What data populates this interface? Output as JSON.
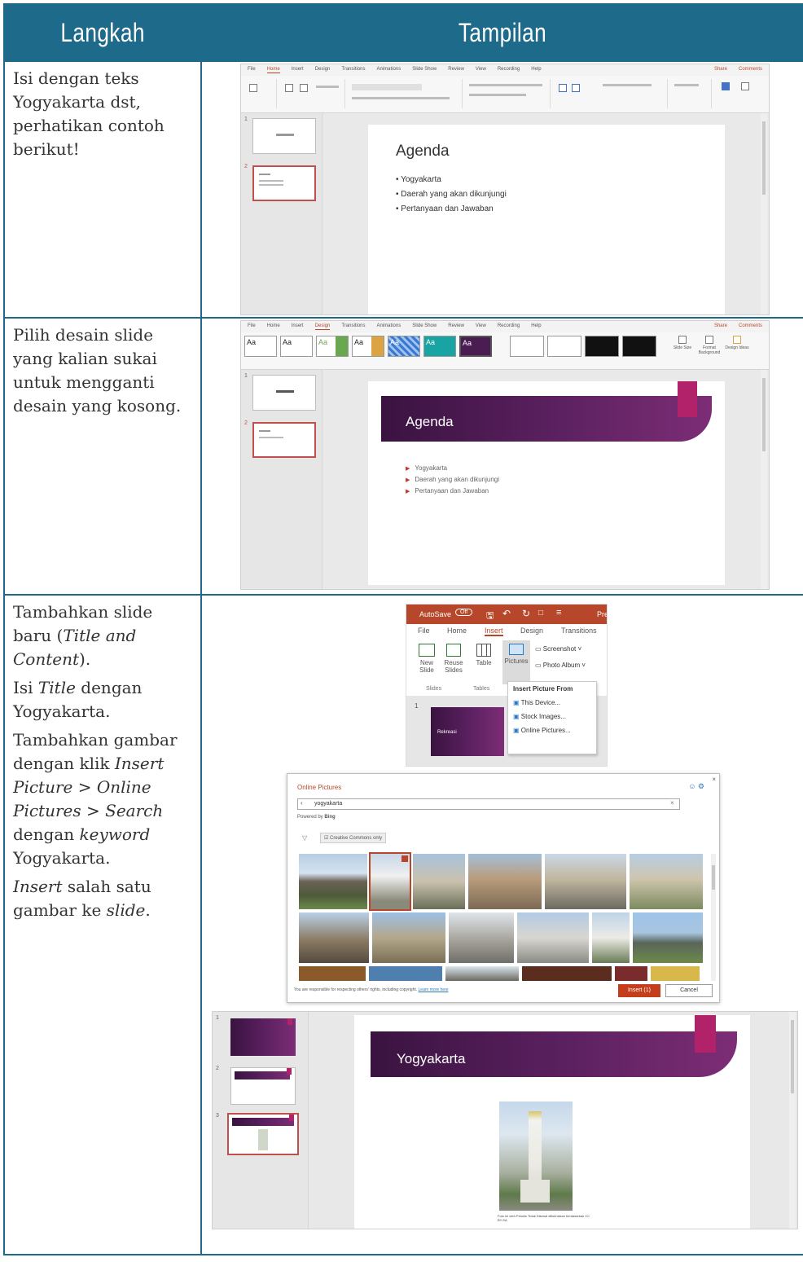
{
  "header": {
    "col_step": "Langkah",
    "col_view": "Tampilan"
  },
  "rows": [
    {
      "step_text": "Isi dengan teks Yogyakarta dst, perhatikan contoh berikut!"
    },
    {
      "step_text": "Pilih desain slide yang kalian sukai untuk mengganti desain yang kosong."
    },
    {
      "step_html_parts": {
        "p1a": "Tambahkan slide baru (",
        "p1b": "Title and Content",
        "p1c": ").",
        "p2a": "Isi ",
        "p2b": "Title",
        "p2c": " dengan Yogyakarta.",
        "p3a": "Tambahkan gambar dengan klik ",
        "p3b": "Insert Picture",
        "p3c": " > ",
        "p3d": "Online Pictures",
        "p3e": " > ",
        "p3f": "Search",
        "p3g": " dengan ",
        "p3h": "keyword",
        "p3i": " Yogyakarta.",
        "p4a": "Insert",
        "p4b": " salah satu gambar ke ",
        "p4c": "slide",
        "p4d": "."
      }
    }
  ],
  "screen1": {
    "tabs": [
      "File",
      "Home",
      "Insert",
      "Design",
      "Transitions",
      "Animations",
      "Slide Show",
      "Review",
      "View",
      "Recording",
      "Help"
    ],
    "share": "Share",
    "comments": "Comments",
    "slide_title": "Agenda",
    "bullets": [
      "Yogyakarta",
      "Daerah yang akan dikunjungi",
      "Pertanyaan dan Jawaban"
    ],
    "thumb_numbers": [
      "1",
      "2"
    ]
  },
  "screen2": {
    "slide_title": "Agenda",
    "bullets": [
      "Yogyakarta",
      "Daerah yang akan dikunjungi",
      "Pertanyaan dan Jawaban"
    ],
    "thumb_numbers": [
      "1",
      "2"
    ],
    "theme_label": "Aa",
    "customize": [
      "Slide Size",
      "Format Background",
      "Design Ideas"
    ]
  },
  "insert_menu": {
    "autosave": "AutoSave",
    "off": "Off",
    "title_suffix": "Pre",
    "tabs": [
      "File",
      "Home",
      "Insert",
      "Design",
      "Transitions"
    ],
    "new_slide": "New Slide",
    "reuse_slides": "Reuse Slides",
    "table": "Table",
    "pictures": "Pictures",
    "screenshot": "Screenshot",
    "photo_album": "Photo Album",
    "group_slides": "Slides",
    "group_tables": "Tables",
    "dropdown_title": "Insert Picture From",
    "dropdown_items": [
      "This Device...",
      "Stock Images...",
      "Online Pictures..."
    ],
    "slide_num": "1",
    "thumb_label": "Rekreasi"
  },
  "online_dialog": {
    "title": "Online Pictures",
    "query": "yogyakarta",
    "powered": "Powered by",
    "bing": "Bing",
    "filter": "Creative Commons only",
    "footer_note": "You are responsible for respecting others' rights, including copyright.",
    "learn_more": "Learn more here",
    "insert_btn": "Insert (1)",
    "cancel_btn": "Cancel"
  },
  "screen3": {
    "slide_title": "Yogyakarta",
    "thumb_numbers": [
      "1",
      "2",
      "3"
    ],
    "caption": "Foto ini oleh Penulis Tidak Dikenal dilisensikan berdasarkan CC BY-SA"
  },
  "colors": {
    "header_bg": "#1e6a8a",
    "accent_red": "#b7472a",
    "purple": "#5c2161",
    "pink": "#b1226a"
  }
}
